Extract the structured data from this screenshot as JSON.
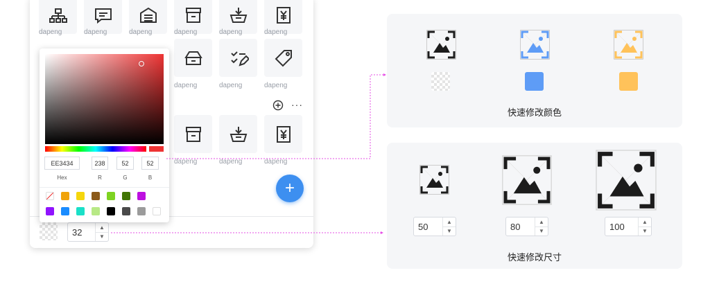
{
  "panel": {
    "tile_label": "dapeng",
    "more_label": "···",
    "bottom": {
      "size_value": "32"
    }
  },
  "color_picker": {
    "hex": "EE3434",
    "r": "238",
    "g": "52",
    "b": "52",
    "hex_label": "Hex",
    "r_label": "R",
    "g_label": "G",
    "b_label": "B",
    "swatches": [
      "#f0a30a",
      "#f5d60c",
      "#8b5a1a",
      "#7ed321",
      "#417505",
      "#bd10e0",
      "#9013fe",
      "#1a8cff",
      "#1ae0c8",
      "#b8e986",
      "#000000",
      "#4a4a4a",
      "#9b9b9b",
      "#ffffff"
    ]
  },
  "color_card": {
    "title": "快速修改颜色",
    "colors": [
      "#1c1c1c",
      "#5e9cf6",
      "#ffc25a"
    ]
  },
  "size_card": {
    "title": "快速修改尺寸",
    "sizes": [
      "50",
      "80",
      "100"
    ]
  },
  "accent": "#3d8ff0",
  "connector": "#e64ce6"
}
